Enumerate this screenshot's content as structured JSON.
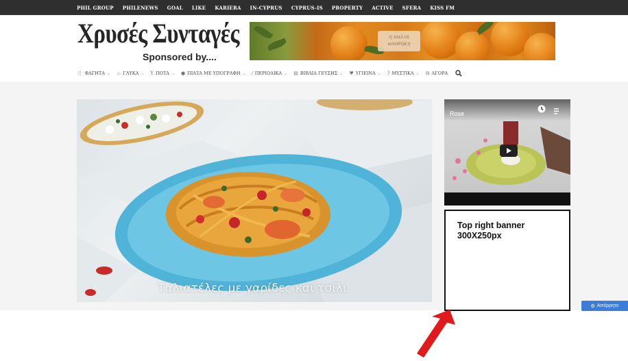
{
  "topbar": {
    "links": [
      "PHIL GROUP",
      "PHILENEWS",
      "GOAL",
      "LIKE",
      "KARIERA",
      "IN-CYPRUS",
      "CYPRUS-IS",
      "PROPERTY",
      "ACTIVE",
      "SFERA",
      "KISS FM"
    ]
  },
  "header": {
    "logo_title": "Χρυσές Συνταγές",
    "logo_sponsor": "Sponsored by....",
    "ad_stamp_line1": "η παλιά",
    "ad_stamp_line2": "αποθήκη"
  },
  "nav": {
    "items": [
      {
        "label": "ΦΑΓΗΤΑ",
        "icon": "fork-knife-icon",
        "glyph": "🍴",
        "dropdown": true
      },
      {
        "label": "ΓΛΥΚΑ",
        "icon": "cake-icon",
        "glyph": "♨",
        "dropdown": true
      },
      {
        "label": "ΠΟΤΑ",
        "icon": "cocktail-icon",
        "glyph": "Y",
        "dropdown": true
      },
      {
        "label": "ΠΙΑΤΑ ΜΕ ΥΠΟΓΡΑΦΗ",
        "icon": "plate-icon",
        "glyph": "●",
        "dropdown": true
      },
      {
        "label": "ΠΕΡΙΟΔΙΚΑ",
        "icon": "pen-icon",
        "glyph": "⁄",
        "dropdown": true
      },
      {
        "label": "ΒΙΒΛΙΑ ΓΕΥΣΗΣ",
        "icon": "book-icon",
        "glyph": "▤",
        "dropdown": true
      },
      {
        "label": "ΥΓΙΕΙΝΑ",
        "icon": "heart-icon",
        "glyph": "♥",
        "dropdown": true
      },
      {
        "label": "ΜΥΣΤΙΚΑ",
        "icon": "question-icon",
        "glyph": "?",
        "dropdown": true
      },
      {
        "label": "ΑΓΟΡΑ",
        "icon": "basket-icon",
        "glyph": "⊟",
        "dropdown": false
      }
    ],
    "chevron": "⌄"
  },
  "hero": {
    "caption": "Ταλιατέλες με γαρίδες και τσίλι"
  },
  "video": {
    "title": "Rose"
  },
  "banner": {
    "line1": "Top right banner",
    "line2": "300X250px"
  },
  "accessibility": {
    "label": "Απόρρητο"
  },
  "colors": {
    "topbar": "#2f2f2f",
    "annotation_arrow": "#e0191c",
    "accessibility_button": "#3b7dd8"
  }
}
